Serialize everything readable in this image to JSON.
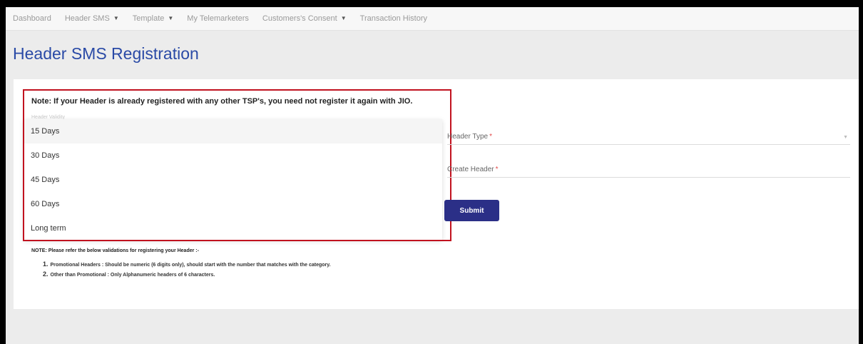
{
  "nav": {
    "items": [
      {
        "label": "Dashboard",
        "has_caret": false
      },
      {
        "label": "Header SMS",
        "has_caret": true
      },
      {
        "label": "Template",
        "has_caret": true
      },
      {
        "label": "My Telemarketers",
        "has_caret": false
      },
      {
        "label": "Customers's Consent",
        "has_caret": true
      },
      {
        "label": "Transaction History",
        "has_caret": false
      }
    ],
    "caret_glyph": "▼"
  },
  "page": {
    "title": "Header SMS Registration"
  },
  "form": {
    "note": "Note: If your Header is already registered with any other TSP's, you need not register it again with JIO.",
    "validity_label": "Header Validity",
    "validity_options": [
      "15 Days",
      "30 Days",
      "45 Days",
      "60 Days",
      "Long term"
    ],
    "validity_highlighted_option": "15 Days",
    "header_type_label": "Header Type",
    "create_header_label": "Create Header",
    "required_marker": "*",
    "select_caret_glyph": "▼",
    "submit_label": "Submit"
  },
  "validation": {
    "title": "NOTE: Please refer the below validations for registering your Header :-",
    "items": [
      {
        "num": "1.",
        "text": "Promotional Headers : Should be numeric (6 digits only), should start with the number that matches with the category."
      },
      {
        "num": "2.",
        "text": "Other than Promotional : Only Alphanumeric headers of 6 characters."
      }
    ]
  },
  "colors": {
    "title_blue": "#2a4aa6",
    "submit_bg": "#2b2f87",
    "highlight_red": "#c1121f",
    "required_red": "#e24a4a"
  }
}
